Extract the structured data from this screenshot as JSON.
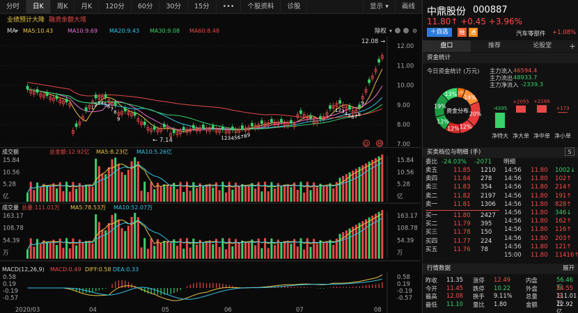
{
  "toolbar": {
    "tabs": [
      "分时",
      "日K",
      "周K",
      "月K",
      "120分",
      "60分",
      "30分",
      "15分",
      "•••",
      "个股资料",
      "诊股"
    ],
    "active_tab": "日K",
    "display_label": "显示",
    "draw_label": "画线"
  },
  "main_chart": {
    "news_tags": [
      "业绩预计大降",
      "融资余额大增"
    ],
    "ma_label": "MA",
    "ma_legend": [
      {
        "label": "MA5:10.43",
        "color": "#e8c547"
      },
      {
        "label": "MA10:9.69",
        "color": "#e86fd0"
      },
      {
        "label": "MA20:9.43",
        "color": "#36c3e8"
      },
      {
        "label": "MA30:9.08",
        "color": "#3ad16b"
      },
      {
        "label": "MA60:8.48",
        "color": "#e84a4a"
      }
    ],
    "adjust_label": "除权",
    "y_ticks": [
      "12.00",
      "11.00",
      "10.00",
      "9.00",
      "8.00",
      "7.00"
    ],
    "high_label": "12.08",
    "low_label": "7.14",
    "markers": [
      "1",
      "2",
      "3",
      "4",
      "5",
      "6",
      "7",
      "8",
      "9"
    ],
    "x_labels": [
      "2020/03",
      "04",
      "05",
      "06",
      "07",
      "08"
    ]
  },
  "turnover_panel": {
    "title": "成交额",
    "legend": [
      {
        "label": "总金额:12.92亿",
        "color": "#e84a4a"
      },
      {
        "label": "MA5:8.23亿",
        "color": "#e8c547"
      },
      {
        "label": "MA10:5.26亿",
        "color": "#36c3e8"
      }
    ],
    "y_ticks": [
      "15.84",
      "10.56",
      "5.28",
      "亿"
    ]
  },
  "volume_panel": {
    "title": "成交量",
    "legend": [
      {
        "label": "总量:111.01万",
        "color": "#e84a4a"
      },
      {
        "label": "MA5:78.53万",
        "color": "#e8c547"
      },
      {
        "label": "MA10:52.07万",
        "color": "#36c3e8"
      }
    ],
    "y_ticks": [
      "163.17",
      "108.78",
      "54.39",
      "万"
    ]
  },
  "macd_panel": {
    "title": "MACD(12,26,9)",
    "legend": [
      {
        "label": "MACD:0.49",
        "color": "#e84a4a"
      },
      {
        "label": "DIFF:0.58",
        "color": "#e8c547"
      },
      {
        "label": "DEA:0.33",
        "color": "#36c3e8"
      }
    ],
    "y_ticks": [
      "0.58",
      "0.19",
      "-0.19",
      "-0.57"
    ]
  },
  "stock": {
    "name": "中鼎股份",
    "code": "000887",
    "price_change": "11.80↑ +0.45 +3.96%",
    "add_watch": "＋自选",
    "tag_margin": "融",
    "tag_connect": "通",
    "industry": "汽车零部件",
    "industry_change": "+1.08%"
  },
  "right_tabs": [
    "盘口",
    "推荐",
    "论股堂"
  ],
  "right_active_tab": "盘口",
  "fund_flow": {
    "title": "资金统计",
    "header": "今日资金统计 (万元)",
    "main_in_label": "主力流入",
    "main_in": "46594.4",
    "main_out_label": "主力流出",
    "main_out": "48933.7",
    "main_net_label": "主力净流入",
    "main_net": "-2339.3",
    "donut_center": "资金分布",
    "donut_slices": [
      {
        "label": "6%",
        "value": 6,
        "color": "#ff6a00"
      },
      {
        "label": "14%",
        "value": 14,
        "color": "#ff8f3a"
      },
      {
        "label": "20%",
        "value": 20,
        "color": "#e83a3a"
      },
      {
        "label": "12%",
        "value": 12,
        "color": "#e83a3a"
      },
      {
        "label": "12%",
        "value": 12,
        "color": "#d62828"
      },
      {
        "label": "12%",
        "value": 12,
        "color": "#1faa4a"
      },
      {
        "label": "19%",
        "value": 19,
        "color": "#1e9a45"
      },
      {
        "label": "13%",
        "value": 13,
        "color": "#3ad16b"
      }
    ],
    "bars": [
      {
        "value_label": "-4395",
        "value": -4395,
        "name": "净特大"
      },
      {
        "value_label": "+2055",
        "value": 2055,
        "name": "净大单"
      },
      {
        "value_label": "+2166",
        "value": 2166,
        "name": "净中单"
      },
      {
        "value_label": "+173",
        "value": 173,
        "name": "净小单"
      }
    ]
  },
  "orderbook": {
    "title": "买卖档位与明细 (手)",
    "wei_label": "委比",
    "wei_ratio": "-24.03%",
    "wei_diff": "-2071",
    "detail_label": "明细",
    "asks": [
      {
        "label": "卖五",
        "price": "11.85",
        "vol": "1210"
      },
      {
        "label": "卖四",
        "price": "11.84",
        "vol": "278"
      },
      {
        "label": "卖三",
        "price": "11.83",
        "vol": "354"
      },
      {
        "label": "卖二",
        "price": "11.82",
        "vol": "2197"
      },
      {
        "label": "卖一",
        "price": "11.81",
        "vol": "1306"
      }
    ],
    "bids": [
      {
        "label": "买一",
        "price": "11.80",
        "vol": "2427"
      },
      {
        "label": "买二",
        "price": "11.79",
        "vol": "395"
      },
      {
        "label": "买三",
        "price": "11.78",
        "vol": "150"
      },
      {
        "label": "买四",
        "price": "11.77",
        "vol": "224"
      },
      {
        "label": "买五",
        "price": "11.76",
        "vol": "78"
      }
    ],
    "ticks": [
      {
        "time": "14:56",
        "price": "11.80",
        "vol": "1002↓"
      },
      {
        "time": "14:56",
        "price": "11.80",
        "vol": "102↑"
      },
      {
        "time": "14:56",
        "price": "11.80",
        "vol": "214↑"
      },
      {
        "time": "14:56",
        "price": "11.80",
        "vol": "191↑"
      },
      {
        "time": "14:56",
        "price": "11.80",
        "vol": "828↑"
      },
      {
        "time": "14:56",
        "price": "11.80",
        "vol": "346↓"
      },
      {
        "time": "14:56",
        "price": "11.80",
        "vol": "162↑"
      },
      {
        "time": "14:56",
        "price": "11.80",
        "vol": "116↑"
      },
      {
        "time": "14:56",
        "price": "11.80",
        "vol": "203↑"
      },
      {
        "time": "14:56",
        "price": "11.80",
        "vol": "121↑"
      },
      {
        "time": "15:00",
        "price": "11.80",
        "vol": "11416↑"
      }
    ]
  },
  "quote": {
    "title": "行情数据",
    "expand": "展开",
    "rows": [
      [
        {
          "l": "昨收",
          "v": "11.35"
        },
        {
          "l": "涨停",
          "v": "12.49"
        },
        {
          "l": "内盘",
          "v": "56.46万"
        }
      ],
      [
        {
          "l": "今开",
          "v": "11.45"
        },
        {
          "l": "跌停",
          "v": "10.22"
        },
        {
          "l": "外盘",
          "v": "54.55万"
        }
      ],
      [
        {
          "l": "最高",
          "v": "12.08"
        },
        {
          "l": "换手",
          "v": "9.11%"
        },
        {
          "l": "总量",
          "v": "111.01万"
        }
      ],
      [
        {
          "l": "最低",
          "v": "11.10"
        },
        {
          "l": "量比",
          "v": "1.80"
        },
        {
          "l": "金额",
          "v": "12.92亿"
        }
      ]
    ]
  }
}
